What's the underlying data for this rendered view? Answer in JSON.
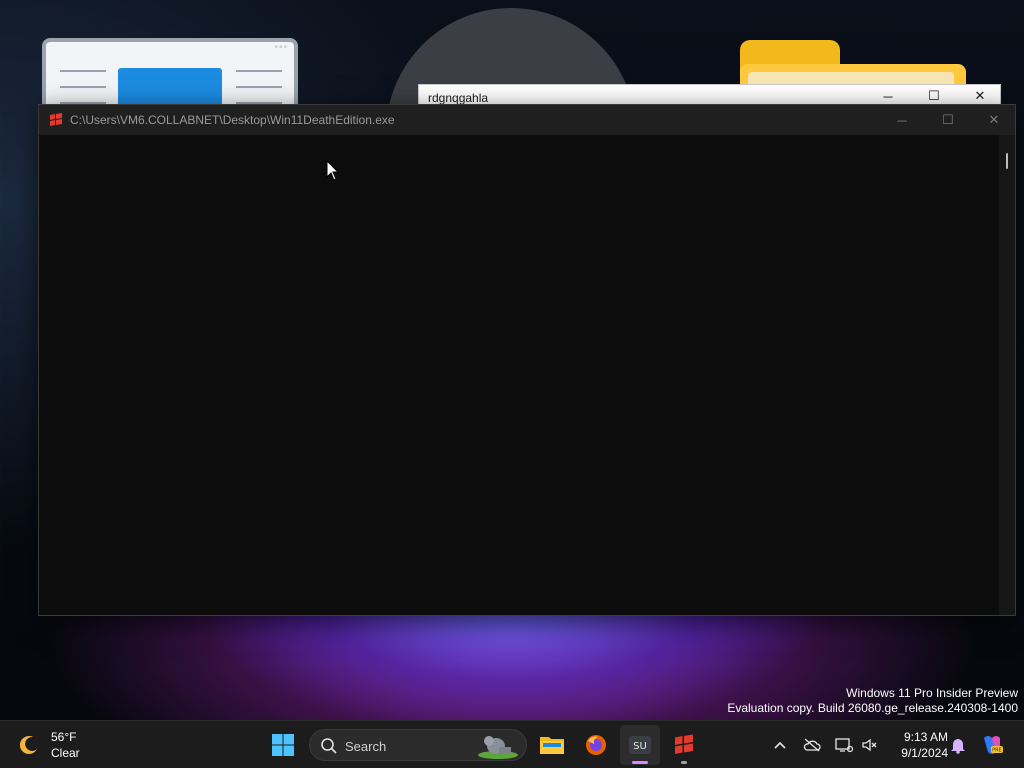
{
  "console_window": {
    "title": "C:\\Users\\VM6.COLLABNET\\Desktop\\Win11DeathEdition.exe",
    "minimize_label": "─",
    "maximize_label": "☐",
    "close_label": "✕"
  },
  "background_window": {
    "title": "rdgnqgahla",
    "minimize_label": "─",
    "maximize_label": "☐",
    "close_label": "✕"
  },
  "watermark": {
    "line1": "Windows 11 Pro Insider Preview",
    "line2": "Evaluation copy. Build 26080.ge_release.240308-1400"
  },
  "taskbar": {
    "weather": {
      "temperature": "56°F",
      "condition": "Clear",
      "icon": "moon-icon"
    },
    "search": {
      "label": "Search",
      "icon": "search-icon"
    },
    "apps": [
      {
        "name": "start",
        "icon": "windows-logo-icon"
      },
      {
        "name": "file-explorer",
        "icon": "folder-icon"
      },
      {
        "name": "firefox",
        "icon": "firefox-icon"
      },
      {
        "name": "su-app",
        "icon": "su-icon",
        "label": "SU",
        "active": true
      },
      {
        "name": "win11deathedition",
        "icon": "red-flag-icon",
        "running": true
      }
    ],
    "tray": {
      "time": "9:13 AM",
      "date": "9/1/2024",
      "icons": [
        "chevron-up-icon",
        "cloud-offline-icon",
        "network-icon",
        "volume-muted-icon",
        "notification-bell-icon",
        "copilot-icon"
      ]
    }
  },
  "colors": {
    "console_bg": "#0c0c0c",
    "titlebar_bg": "#1f1f1f",
    "taskbar_bg": "#1c1c1c",
    "accent": "#0078d4"
  }
}
